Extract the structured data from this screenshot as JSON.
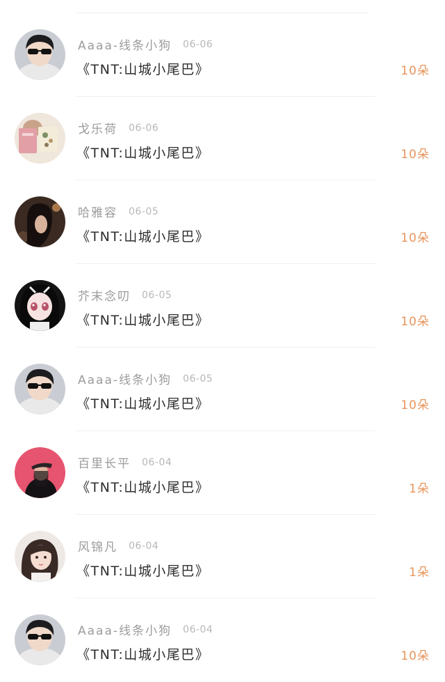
{
  "gift_list": [
    {
      "username": "Aaaa-线条小狗",
      "date": "06-06",
      "title": "《TNT:山城小尾巴》",
      "count": "10朵",
      "avatar_icon": "avatar-sunglasses-person"
    },
    {
      "username": "戈乐荷",
      "date": "06-06",
      "title": "《TNT:山城小尾巴》",
      "count": "10朵",
      "avatar_icon": "avatar-person-holding-book"
    },
    {
      "username": "哈雅容",
      "date": "06-05",
      "title": "《TNT:山城小尾巴》",
      "count": "10朵",
      "avatar_icon": "avatar-dark-portrait"
    },
    {
      "username": "芥末念叨",
      "date": "06-05",
      "title": "《TNT:山城小尾巴》",
      "count": "10朵",
      "avatar_icon": "avatar-anime-girl"
    },
    {
      "username": "Aaaa-线条小狗",
      "date": "06-05",
      "title": "《TNT:山城小尾巴》",
      "count": "10朵",
      "avatar_icon": "avatar-sunglasses-person"
    },
    {
      "username": "百里长平",
      "date": "06-04",
      "title": "《TNT:山城小尾巴》",
      "count": "1朵",
      "avatar_icon": "avatar-pink-background-person"
    },
    {
      "username": "风锦凡",
      "date": "06-04",
      "title": "《TNT:山城小尾巴》",
      "count": "1朵",
      "avatar_icon": "avatar-girl-portrait"
    },
    {
      "username": "Aaaa-线条小狗",
      "date": "06-04",
      "title": "《TNT:山城小尾巴》",
      "count": "10朵",
      "avatar_icon": "avatar-sunglasses-person"
    }
  ],
  "colors": {
    "username": "#9b9b9b",
    "date": "#b7b7b7",
    "title": "#2e2e2e",
    "count": "#e8955c",
    "divider": "#efefef"
  }
}
